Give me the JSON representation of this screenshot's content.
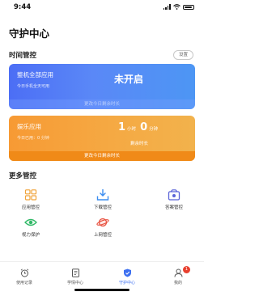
{
  "status_bar": {
    "time": "9:44"
  },
  "page": {
    "title": "守护中心"
  },
  "time_control": {
    "section_title": "时间管控",
    "settings_label": "设置",
    "device_card": {
      "title": "整机全部应用",
      "subtitle": "今日手机全天可用",
      "status": "未开启",
      "footer": "更改今日剩余时长"
    },
    "entertainment_card": {
      "title": "娱乐应用",
      "used": "今日已用：0 分钟",
      "remain_hours": "1",
      "hours_unit": "小时",
      "remain_minutes": "0",
      "minutes_unit": "分钟",
      "remain_label": "剩余时长",
      "footer": "更改今日剩余时长"
    }
  },
  "more_control": {
    "section_title": "更多管控",
    "items": [
      {
        "label": "应用管控",
        "icon": "grid-apps-icon"
      },
      {
        "label": "下载管控",
        "icon": "download-tray-icon"
      },
      {
        "label": "答案管控",
        "icon": "answer-box-icon"
      },
      {
        "label": "视力保护",
        "icon": "eye-icon"
      },
      {
        "label": "上网管控",
        "icon": "planet-icon"
      }
    ]
  },
  "tabbar": {
    "items": [
      {
        "label": "使用记录",
        "icon": "alarm-clock-icon"
      },
      {
        "label": "学情中心",
        "icon": "notebook-icon"
      },
      {
        "label": "守护中心",
        "icon": "shield-icon",
        "active": true
      },
      {
        "label": "我的",
        "icon": "person-icon",
        "badge": "1"
      }
    ]
  },
  "colors": {
    "accent_blue": "#4c6ef5",
    "accent_orange": "#f79a34",
    "active_tab": "#3c6ff0",
    "badge": "#e8402f"
  }
}
